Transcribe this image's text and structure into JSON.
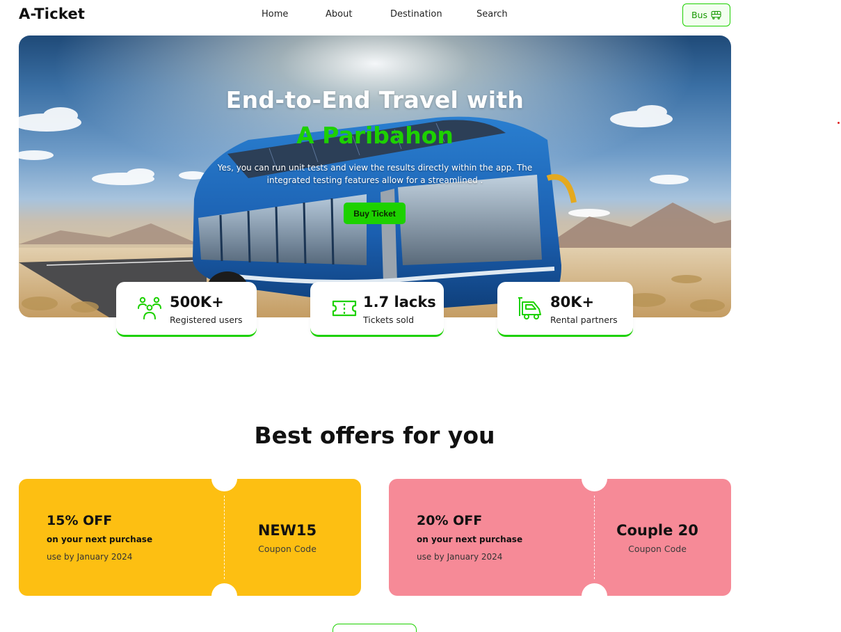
{
  "header": {
    "logo": "A-Ticket",
    "nav": [
      "Home",
      "About",
      "Destination",
      "Search"
    ],
    "bus_button": {
      "label": "Bus",
      "icon": "bus-icon"
    }
  },
  "hero": {
    "title_line1": "End-to-End Travel with",
    "title_line2": "A Paribahon",
    "text": "Yes, you can run unit tests and view the results directly within the app. The integrated testing features allow for a streamlined .",
    "button_label": "Buy Ticket"
  },
  "stats": [
    {
      "value": "500K+",
      "label": "Registered users",
      "icon": "users-icon"
    },
    {
      "value": "1.7 lacks",
      "label": "Tickets sold",
      "icon": "ticket-icon"
    },
    {
      "value": "80K+",
      "label": "Rental partners",
      "icon": "rental-icon"
    }
  ],
  "offers": {
    "title": "Best offers for you",
    "coupons": [
      {
        "percent": "15% OFF",
        "subtitle": "on your next purchase",
        "use_by": "use by January 2024",
        "code": "NEW15",
        "code_label": "Coupon Code"
      },
      {
        "percent": "20% OFF",
        "subtitle": "on your next purchase",
        "use_by": "use by January 2024",
        "code": "Couple 20",
        "code_label": "Coupon Code"
      }
    ]
  },
  "colors": {
    "accent": "#1DD100",
    "coupon_yellow": "#FDBF12",
    "coupon_pink": "#F68A97",
    "text_dark": "#111111"
  }
}
